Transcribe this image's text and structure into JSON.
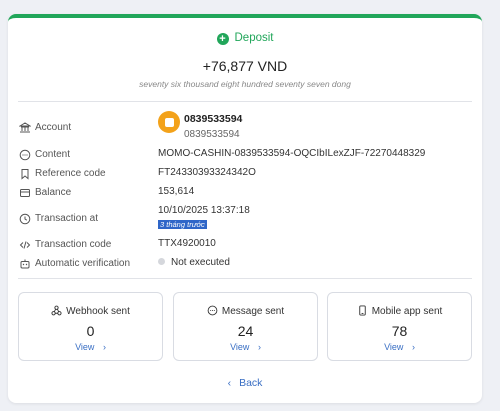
{
  "header": {
    "title": "Deposit",
    "amount": "+76,877 VND",
    "amount_words": "seventy six thousand eight hundred seventy seven dong"
  },
  "details": {
    "account": {
      "label": "Account",
      "name": "0839533594",
      "number": "0839533594"
    },
    "content": {
      "label": "Content",
      "value": "MOMO-CASHIN-0839533594-OQCIbILexZJF-72270448329"
    },
    "reference": {
      "label": "Reference code",
      "value": "FT24330393324342O"
    },
    "balance": {
      "label": "Balance",
      "value": "153,614"
    },
    "transaction_at": {
      "label": "Transaction at",
      "value": "10/10/2025 13:37:18",
      "relative": "3 tháng trước"
    },
    "transaction_code": {
      "label": "Transaction code",
      "value": "TTX4920010"
    },
    "verification": {
      "label": "Automatic verification",
      "value": "Not executed"
    }
  },
  "stats": [
    {
      "title": "Webhook sent",
      "count": "0",
      "view": "View"
    },
    {
      "title": "Message sent",
      "count": "24",
      "view": "View"
    },
    {
      "title": "Mobile app sent",
      "count": "78",
      "view": "View"
    }
  ],
  "footer": {
    "back_label": "Back"
  },
  "colors": {
    "accent": "#21a65a",
    "link": "#3a6fc4",
    "logo": "#f3a21a"
  }
}
